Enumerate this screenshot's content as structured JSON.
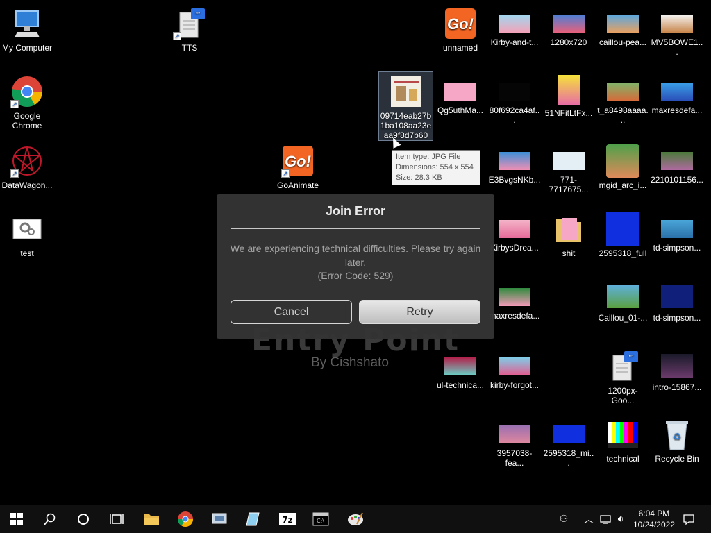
{
  "desktop": {
    "icons": {
      "my_computer": "My Computer",
      "tts": "TTS",
      "unnamed": "unnamed",
      "kirby_and_t": "Kirby-and-t...",
      "res_1280x720": "1280x720",
      "caillou_pea": "caillou-pea...",
      "mv5bowe1": "MV5BOWE1...",
      "google_chrome": "Google Chrome",
      "selected_jpg": "09714eab27b1ba108aa23eaa9f8d7b60",
      "qg5uthma": "Qg5uthMa...",
      "f692ca4af": "80f692ca4af...",
      "nfitltfx": "51NFitLtFx...",
      "t_a8498aaaa": "t_a8498aaaa...",
      "maxresdefa_1": "maxresdefa...",
      "datawagon": "DataWagon...",
      "goanimate": "GoAnimate",
      "e3bvgsnkb": "E3BvgsNKb...",
      "n771": "771-7717675...",
      "mgid_arc_i": "mgid_arc_i...",
      "n2210101156": "2210101156...",
      "test": "test",
      "kirbysdrea": "KirbysDrea...",
      "shit": "shit",
      "n2595318_full": "2595318_full",
      "td_simpson_1": "td-simpson...",
      "maxresdefa_2": "maxresdefa...",
      "caillou_01": "Caillou_01-...",
      "td_simpson_2": "td-simpson...",
      "ul_technica": "ul-technica...",
      "kirby_forgot": "kirby-forgot...",
      "n1200px_goo": "1200px-Goo...",
      "intro_15867": "intro-15867...",
      "n3957038_fea": "3957038-fea...",
      "n2595318_mi": "2595318_mi...",
      "technical": "technical",
      "recycle_bin": "Recycle Bin"
    },
    "tooltip": {
      "type": "Item type: JPG File",
      "dimensions": "Dimensions: 554 x 554",
      "size": "Size: 28.3 KB"
    },
    "game_background": {
      "title": "Entry Point",
      "byline": "By Cishshato"
    }
  },
  "dialog": {
    "title": "Join Error",
    "message": "We are experiencing technical difficulties. Please try again later.",
    "code": "(Error Code: 529)",
    "cancel_label": "Cancel",
    "retry_label": "Retry"
  },
  "taskbar": {
    "time": "6:04 PM",
    "date": "10/24/2022",
    "pinned": [
      "start-icon",
      "search-icon",
      "cortana-icon",
      "task-view-icon",
      "file-explorer-icon",
      "chrome-icon",
      "app-icon",
      "notepad-icon",
      "7zip-icon",
      "terminal-icon",
      "paint-icon"
    ]
  },
  "colors": {
    "dialog_bg": "#343434",
    "retry_bg": "#d4d4d4",
    "taskbar_bg": "#101010",
    "goanimate_orange": "#f26522"
  }
}
